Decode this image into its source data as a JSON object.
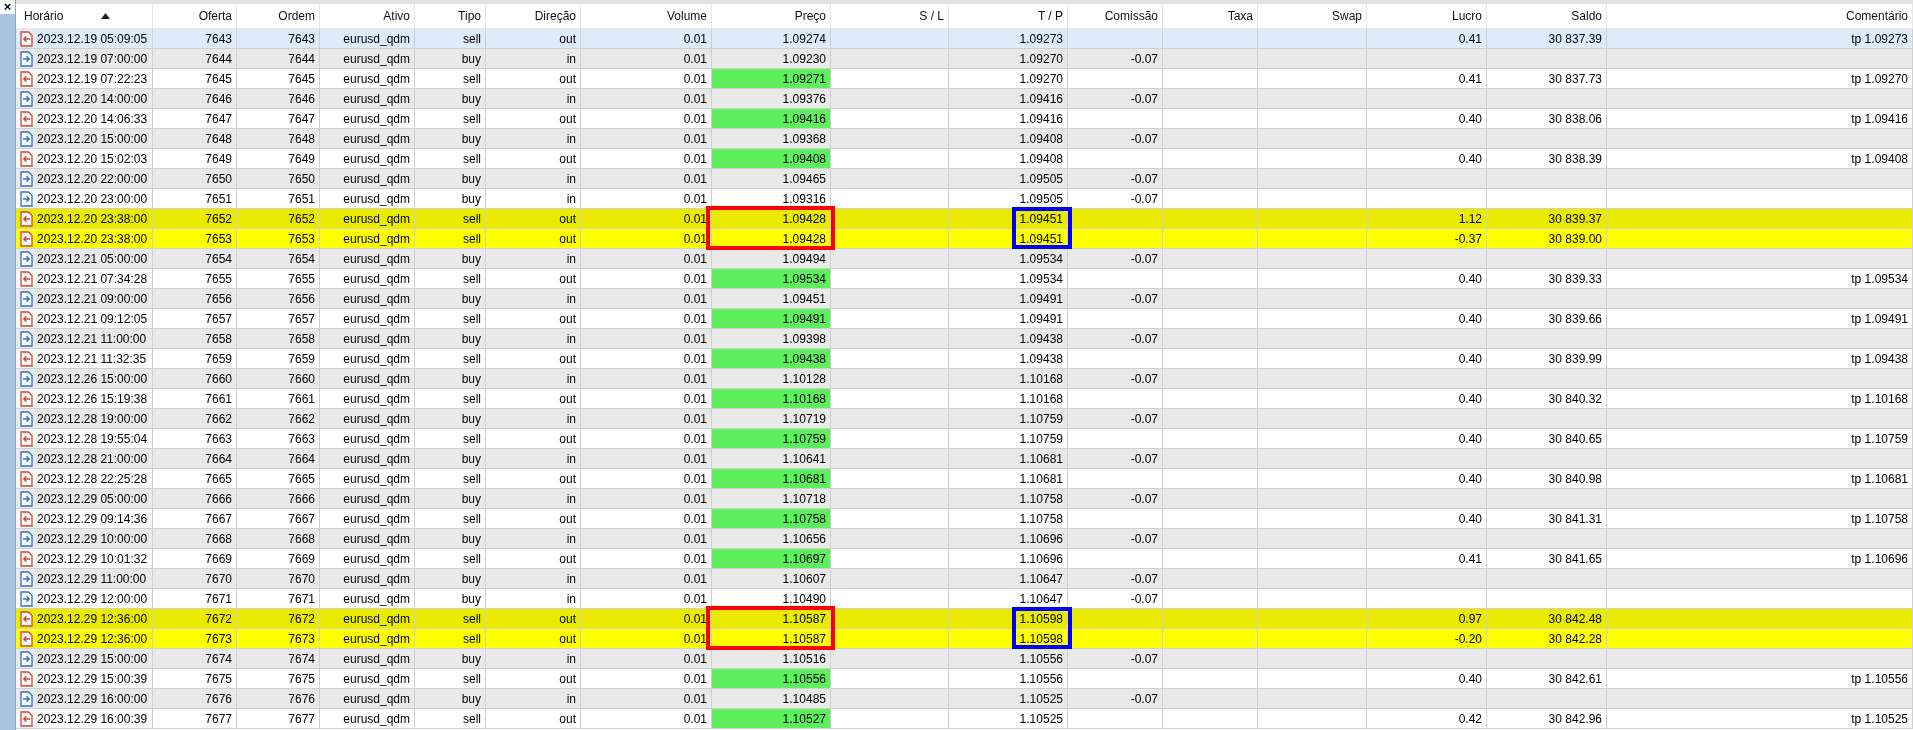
{
  "close_label": "×",
  "columns": [
    {
      "label": "Horário",
      "sorted": true
    },
    {
      "label": "Oferta",
      "sorted": false
    },
    {
      "label": "Ordem",
      "sorted": false
    },
    {
      "label": "Ativo",
      "sorted": false
    },
    {
      "label": "Tipo",
      "sorted": false
    },
    {
      "label": "Direção",
      "sorted": false
    },
    {
      "label": "Volume",
      "sorted": false
    },
    {
      "label": "Preço",
      "sorted": false
    },
    {
      "label": "S / L",
      "sorted": false
    },
    {
      "label": "T / P",
      "sorted": false
    },
    {
      "label": "Comissão",
      "sorted": false
    },
    {
      "label": "Taxa",
      "sorted": false
    },
    {
      "label": "Swap",
      "sorted": false
    },
    {
      "label": "Lucro",
      "sorted": false
    },
    {
      "label": "Saldo",
      "sorted": false
    },
    {
      "label": "Comentário",
      "sorted": false
    }
  ],
  "rows": [
    {
      "kind": "sell",
      "selected": true,
      "highlighted": false,
      "tp_hit": false,
      "time": "2023.12.19 05:09:05",
      "deal": "7643",
      "order": "7643",
      "symbol": "eurusd_qdm",
      "type": "sell",
      "direction": "out",
      "volume": "0.01",
      "price": "1.09274",
      "tp": "1.09273",
      "profit": "0.41",
      "balance": "30 837.39",
      "comment": "tp 1.09273"
    },
    {
      "kind": "buy",
      "selected": false,
      "highlighted": false,
      "tp_hit": false,
      "time": "2023.12.19 07:00:00",
      "deal": "7644",
      "order": "7644",
      "symbol": "eurusd_qdm",
      "type": "buy",
      "direction": "in",
      "volume": "0.01",
      "price": "1.09230",
      "tp": "1.09270",
      "commission": "-0.07"
    },
    {
      "kind": "sell",
      "selected": false,
      "highlighted": false,
      "tp_hit": true,
      "time": "2023.12.19 07:22:23",
      "deal": "7645",
      "order": "7645",
      "symbol": "eurusd_qdm",
      "type": "sell",
      "direction": "out",
      "volume": "0.01",
      "price": "1.09271",
      "tp": "1.09270",
      "profit": "0.41",
      "balance": "30 837.73",
      "comment": "tp 1.09270"
    },
    {
      "kind": "buy",
      "selected": false,
      "highlighted": false,
      "tp_hit": false,
      "time": "2023.12.20 14:00:00",
      "deal": "7646",
      "order": "7646",
      "symbol": "eurusd_qdm",
      "type": "buy",
      "direction": "in",
      "volume": "0.01",
      "price": "1.09376",
      "tp": "1.09416",
      "commission": "-0.07"
    },
    {
      "kind": "sell",
      "selected": false,
      "highlighted": false,
      "tp_hit": true,
      "time": "2023.12.20 14:06:33",
      "deal": "7647",
      "order": "7647",
      "symbol": "eurusd_qdm",
      "type": "sell",
      "direction": "out",
      "volume": "0.01",
      "price": "1.09416",
      "tp": "1.09416",
      "profit": "0.40",
      "balance": "30 838.06",
      "comment": "tp 1.09416"
    },
    {
      "kind": "buy",
      "selected": false,
      "highlighted": false,
      "tp_hit": false,
      "time": "2023.12.20 15:00:00",
      "deal": "7648",
      "order": "7648",
      "symbol": "eurusd_qdm",
      "type": "buy",
      "direction": "in",
      "volume": "0.01",
      "price": "1.09368",
      "tp": "1.09408",
      "commission": "-0.07"
    },
    {
      "kind": "sell",
      "selected": false,
      "highlighted": false,
      "tp_hit": true,
      "time": "2023.12.20 15:02:03",
      "deal": "7649",
      "order": "7649",
      "symbol": "eurusd_qdm",
      "type": "sell",
      "direction": "out",
      "volume": "0.01",
      "price": "1.09408",
      "tp": "1.09408",
      "profit": "0.40",
      "balance": "30 838.39",
      "comment": "tp 1.09408"
    },
    {
      "kind": "buy",
      "selected": false,
      "highlighted": false,
      "tp_hit": false,
      "time": "2023.12.20 22:00:00",
      "deal": "7650",
      "order": "7650",
      "symbol": "eurusd_qdm",
      "type": "buy",
      "direction": "in",
      "volume": "0.01",
      "price": "1.09465",
      "tp": "1.09505",
      "commission": "-0.07"
    },
    {
      "kind": "buy",
      "selected": false,
      "highlighted": false,
      "tp_hit": false,
      "time": "2023.12.20 23:00:00",
      "deal": "7651",
      "order": "7651",
      "symbol": "eurusd_qdm",
      "type": "buy",
      "direction": "in",
      "volume": "0.01",
      "price": "1.09316",
      "tp": "1.09505",
      "commission": "-0.07"
    },
    {
      "kind": "sell",
      "selected": false,
      "highlighted": true,
      "tp_hit": false,
      "time": "2023.12.20 23:38:00",
      "deal": "7652",
      "order": "7652",
      "symbol": "eurusd_qdm",
      "type": "sell",
      "direction": "out",
      "volume": "0.01",
      "price": "1.09428",
      "tp": "1.09451",
      "profit": "1.12",
      "balance": "30 839.37"
    },
    {
      "kind": "sell",
      "selected": false,
      "highlighted": true,
      "tp_hit": false,
      "time": "2023.12.20 23:38:00",
      "deal": "7653",
      "order": "7653",
      "symbol": "eurusd_qdm",
      "type": "sell",
      "direction": "out",
      "volume": "0.01",
      "price": "1.09428",
      "tp": "1.09451",
      "profit": "-0.37",
      "balance": "30 839.00"
    },
    {
      "kind": "buy",
      "selected": false,
      "highlighted": false,
      "tp_hit": false,
      "time": "2023.12.21 05:00:00",
      "deal": "7654",
      "order": "7654",
      "symbol": "eurusd_qdm",
      "type": "buy",
      "direction": "in",
      "volume": "0.01",
      "price": "1.09494",
      "tp": "1.09534",
      "commission": "-0.07"
    },
    {
      "kind": "sell",
      "selected": false,
      "highlighted": false,
      "tp_hit": true,
      "time": "2023.12.21 07:34:28",
      "deal": "7655",
      "order": "7655",
      "symbol": "eurusd_qdm",
      "type": "sell",
      "direction": "out",
      "volume": "0.01",
      "price": "1.09534",
      "tp": "1.09534",
      "profit": "0.40",
      "balance": "30 839.33",
      "comment": "tp 1.09534"
    },
    {
      "kind": "buy",
      "selected": false,
      "highlighted": false,
      "tp_hit": false,
      "time": "2023.12.21 09:00:00",
      "deal": "7656",
      "order": "7656",
      "symbol": "eurusd_qdm",
      "type": "buy",
      "direction": "in",
      "volume": "0.01",
      "price": "1.09451",
      "tp": "1.09491",
      "commission": "-0.07"
    },
    {
      "kind": "sell",
      "selected": false,
      "highlighted": false,
      "tp_hit": true,
      "time": "2023.12.21 09:12:05",
      "deal": "7657",
      "order": "7657",
      "symbol": "eurusd_qdm",
      "type": "sell",
      "direction": "out",
      "volume": "0.01",
      "price": "1.09491",
      "tp": "1.09491",
      "profit": "0.40",
      "balance": "30 839.66",
      "comment": "tp 1.09491"
    },
    {
      "kind": "buy",
      "selected": false,
      "highlighted": false,
      "tp_hit": false,
      "time": "2023.12.21 11:00:00",
      "deal": "7658",
      "order": "7658",
      "symbol": "eurusd_qdm",
      "type": "buy",
      "direction": "in",
      "volume": "0.01",
      "price": "1.09398",
      "tp": "1.09438",
      "commission": "-0.07"
    },
    {
      "kind": "sell",
      "selected": false,
      "highlighted": false,
      "tp_hit": true,
      "time": "2023.12.21 11:32:35",
      "deal": "7659",
      "order": "7659",
      "symbol": "eurusd_qdm",
      "type": "sell",
      "direction": "out",
      "volume": "0.01",
      "price": "1.09438",
      "tp": "1.09438",
      "profit": "0.40",
      "balance": "30 839.99",
      "comment": "tp 1.09438"
    },
    {
      "kind": "buy",
      "selected": false,
      "highlighted": false,
      "tp_hit": false,
      "time": "2023.12.26 15:00:00",
      "deal": "7660",
      "order": "7660",
      "symbol": "eurusd_qdm",
      "type": "buy",
      "direction": "in",
      "volume": "0.01",
      "price": "1.10128",
      "tp": "1.10168",
      "commission": "-0.07"
    },
    {
      "kind": "sell",
      "selected": false,
      "highlighted": false,
      "tp_hit": true,
      "time": "2023.12.26 15:19:38",
      "deal": "7661",
      "order": "7661",
      "symbol": "eurusd_qdm",
      "type": "sell",
      "direction": "out",
      "volume": "0.01",
      "price": "1.10168",
      "tp": "1.10168",
      "profit": "0.40",
      "balance": "30 840.32",
      "comment": "tp 1.10168"
    },
    {
      "kind": "buy",
      "selected": false,
      "highlighted": false,
      "tp_hit": false,
      "time": "2023.12.28 19:00:00",
      "deal": "7662",
      "order": "7662",
      "symbol": "eurusd_qdm",
      "type": "buy",
      "direction": "in",
      "volume": "0.01",
      "price": "1.10719",
      "tp": "1.10759",
      "commission": "-0.07"
    },
    {
      "kind": "sell",
      "selected": false,
      "highlighted": false,
      "tp_hit": true,
      "time": "2023.12.28 19:55:04",
      "deal": "7663",
      "order": "7663",
      "symbol": "eurusd_qdm",
      "type": "sell",
      "direction": "out",
      "volume": "0.01",
      "price": "1.10759",
      "tp": "1.10759",
      "profit": "0.40",
      "balance": "30 840.65",
      "comment": "tp 1.10759"
    },
    {
      "kind": "buy",
      "selected": false,
      "highlighted": false,
      "tp_hit": false,
      "time": "2023.12.28 21:00:00",
      "deal": "7664",
      "order": "7664",
      "symbol": "eurusd_qdm",
      "type": "buy",
      "direction": "in",
      "volume": "0.01",
      "price": "1.10641",
      "tp": "1.10681",
      "commission": "-0.07"
    },
    {
      "kind": "sell",
      "selected": false,
      "highlighted": false,
      "tp_hit": true,
      "time": "2023.12.28 22:25:28",
      "deal": "7665",
      "order": "7665",
      "symbol": "eurusd_qdm",
      "type": "sell",
      "direction": "out",
      "volume": "0.01",
      "price": "1.10681",
      "tp": "1.10681",
      "profit": "0.40",
      "balance": "30 840.98",
      "comment": "tp 1.10681"
    },
    {
      "kind": "buy",
      "selected": false,
      "highlighted": false,
      "tp_hit": false,
      "time": "2023.12.29 05:00:00",
      "deal": "7666",
      "order": "7666",
      "symbol": "eurusd_qdm",
      "type": "buy",
      "direction": "in",
      "volume": "0.01",
      "price": "1.10718",
      "tp": "1.10758",
      "commission": "-0.07"
    },
    {
      "kind": "sell",
      "selected": false,
      "highlighted": false,
      "tp_hit": true,
      "time": "2023.12.29 09:14:36",
      "deal": "7667",
      "order": "7667",
      "symbol": "eurusd_qdm",
      "type": "sell",
      "direction": "out",
      "volume": "0.01",
      "price": "1.10758",
      "tp": "1.10758",
      "profit": "0.40",
      "balance": "30 841.31",
      "comment": "tp 1.10758"
    },
    {
      "kind": "buy",
      "selected": false,
      "highlighted": false,
      "tp_hit": false,
      "time": "2023.12.29 10:00:00",
      "deal": "7668",
      "order": "7668",
      "symbol": "eurusd_qdm",
      "type": "buy",
      "direction": "in",
      "volume": "0.01",
      "price": "1.10656",
      "tp": "1.10696",
      "commission": "-0.07"
    },
    {
      "kind": "sell",
      "selected": false,
      "highlighted": false,
      "tp_hit": true,
      "time": "2023.12.29 10:01:32",
      "deal": "7669",
      "order": "7669",
      "symbol": "eurusd_qdm",
      "type": "sell",
      "direction": "out",
      "volume": "0.01",
      "price": "1.10697",
      "tp": "1.10696",
      "profit": "0.41",
      "balance": "30 841.65",
      "comment": "tp 1.10696"
    },
    {
      "kind": "buy",
      "selected": false,
      "highlighted": false,
      "tp_hit": false,
      "time": "2023.12.29 11:00:00",
      "deal": "7670",
      "order": "7670",
      "symbol": "eurusd_qdm",
      "type": "buy",
      "direction": "in",
      "volume": "0.01",
      "price": "1.10607",
      "tp": "1.10647",
      "commission": "-0.07"
    },
    {
      "kind": "buy",
      "selected": false,
      "highlighted": false,
      "tp_hit": false,
      "time": "2023.12.29 12:00:00",
      "deal": "7671",
      "order": "7671",
      "symbol": "eurusd_qdm",
      "type": "buy",
      "direction": "in",
      "volume": "0.01",
      "price": "1.10490",
      "tp": "1.10647",
      "commission": "-0.07"
    },
    {
      "kind": "sell",
      "selected": false,
      "highlighted": true,
      "tp_hit": false,
      "time": "2023.12.29 12:36:00",
      "deal": "7672",
      "order": "7672",
      "symbol": "eurusd_qdm",
      "type": "sell",
      "direction": "out",
      "volume": "0.01",
      "price": "1.10587",
      "tp": "1.10598",
      "profit": "0.97",
      "balance": "30 842.48"
    },
    {
      "kind": "sell",
      "selected": false,
      "highlighted": true,
      "tp_hit": false,
      "time": "2023.12.29 12:36:00",
      "deal": "7673",
      "order": "7673",
      "symbol": "eurusd_qdm",
      "type": "sell",
      "direction": "out",
      "volume": "0.01",
      "price": "1.10587",
      "tp": "1.10598",
      "profit": "-0.20",
      "balance": "30 842.28"
    },
    {
      "kind": "buy",
      "selected": false,
      "highlighted": false,
      "tp_hit": false,
      "time": "2023.12.29 15:00:00",
      "deal": "7674",
      "order": "7674",
      "symbol": "eurusd_qdm",
      "type": "buy",
      "direction": "in",
      "volume": "0.01",
      "price": "1.10516",
      "tp": "1.10556",
      "commission": "-0.07"
    },
    {
      "kind": "sell",
      "selected": false,
      "highlighted": false,
      "tp_hit": true,
      "time": "2023.12.29 15:00:39",
      "deal": "7675",
      "order": "7675",
      "symbol": "eurusd_qdm",
      "type": "sell",
      "direction": "out",
      "volume": "0.01",
      "price": "1.10556",
      "tp": "1.10556",
      "profit": "0.40",
      "balance": "30 842.61",
      "comment": "tp 1.10556"
    },
    {
      "kind": "buy",
      "selected": false,
      "highlighted": false,
      "tp_hit": false,
      "time": "2023.12.29 16:00:00",
      "deal": "7676",
      "order": "7676",
      "symbol": "eurusd_qdm",
      "type": "buy",
      "direction": "in",
      "volume": "0.01",
      "price": "1.10485",
      "tp": "1.10525",
      "commission": "-0.07"
    },
    {
      "kind": "sell",
      "selected": false,
      "highlighted": false,
      "tp_hit": true,
      "time": "2023.12.29 16:00:39",
      "deal": "7677",
      "order": "7677",
      "symbol": "eurusd_qdm",
      "type": "sell",
      "direction": "out",
      "volume": "0.01",
      "price": "1.10527",
      "tp": "1.10525",
      "profit": "0.42",
      "balance": "30 842.96",
      "comment": "tp 1.10525"
    }
  ]
}
